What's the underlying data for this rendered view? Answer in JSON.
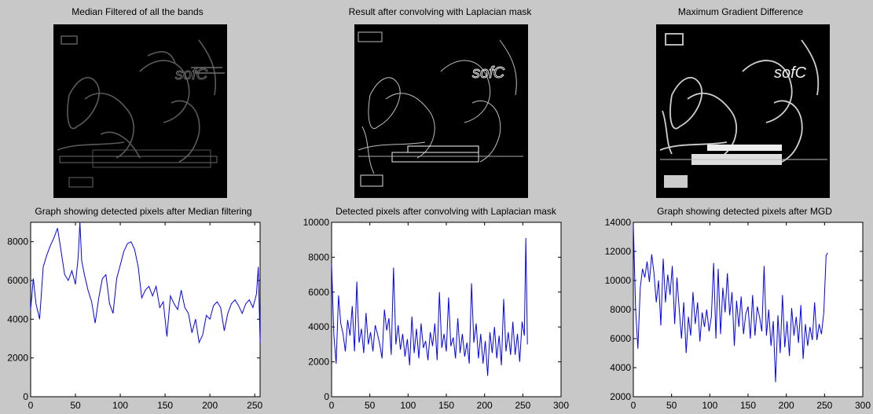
{
  "image_panels": [
    {
      "title": "Median Filtered of all the bands"
    },
    {
      "title": "Result after convolving with Laplacian mask"
    },
    {
      "title": "Maximum Gradient Difference"
    }
  ],
  "chart_data": [
    {
      "type": "line",
      "title": "Graph showing detected pixels after Median filtering",
      "xlabel": "",
      "ylabel": "",
      "xlim": [
        0,
        256
      ],
      "ylim": [
        0,
        9000
      ],
      "xticks": [
        0,
        50,
        100,
        150,
        200,
        250
      ],
      "yticks": [
        0,
        2000,
        4000,
        6000,
        8000
      ],
      "grid": false,
      "color": "#0000ff",
      "series": [
        {
          "x": [
            0,
            3,
            6,
            10,
            14,
            18,
            22,
            26,
            30,
            34,
            38,
            42,
            46,
            50,
            53,
            55,
            57,
            60,
            64,
            68,
            72,
            76,
            80,
            84,
            88,
            92,
            96,
            100,
            104,
            108,
            112,
            116,
            120,
            124,
            128,
            132,
            136,
            140,
            144,
            148,
            152,
            156,
            160,
            164,
            168,
            172,
            176,
            180,
            184,
            188,
            192,
            196,
            200,
            204,
            208,
            212,
            216,
            220,
            224,
            228,
            232,
            236,
            240,
            244,
            248,
            252,
            254,
            256
          ],
          "values": [
            4500,
            6100,
            4800,
            4000,
            6700,
            7300,
            7800,
            8200,
            8700,
            7500,
            6300,
            6000,
            6500,
            5800,
            7200,
            9000,
            7000,
            6300,
            5500,
            4900,
            3800,
            5100,
            6100,
            6300,
            4800,
            4300,
            6100,
            6800,
            7500,
            7900,
            8000,
            7600,
            6700,
            5100,
            5500,
            5700,
            5200,
            5700,
            4600,
            4900,
            3100,
            5200,
            4800,
            4500,
            5500,
            4600,
            4300,
            3300,
            4000,
            2800,
            3200,
            4200,
            4000,
            4700,
            4900,
            4600,
            3400,
            4300,
            4800,
            5000,
            4700,
            4300,
            4800,
            5000,
            4600,
            5300,
            6700,
            2800
          ]
        }
      ]
    },
    {
      "type": "line",
      "title": "Detected pixels after convolving with Laplacian mask",
      "xlabel": "",
      "ylabel": "",
      "xlim": [
        0,
        300
      ],
      "ylim": [
        0,
        10000
      ],
      "xticks": [
        0,
        50,
        100,
        150,
        200,
        250,
        300
      ],
      "yticks": [
        0,
        2000,
        4000,
        6000,
        8000,
        10000
      ],
      "grid": false,
      "color": "#0000ff",
      "series": [
        {
          "x": [
            0,
            3,
            6,
            9,
            12,
            15,
            18,
            21,
            24,
            27,
            30,
            33,
            36,
            39,
            42,
            45,
            48,
            51,
            54,
            57,
            60,
            63,
            66,
            69,
            72,
            75,
            78,
            81,
            84,
            87,
            90,
            93,
            96,
            99,
            102,
            105,
            108,
            111,
            114,
            117,
            120,
            123,
            126,
            129,
            132,
            135,
            138,
            141,
            144,
            147,
            150,
            153,
            156,
            159,
            162,
            165,
            168,
            171,
            174,
            177,
            180,
            183,
            186,
            189,
            192,
            195,
            198,
            201,
            204,
            207,
            210,
            213,
            216,
            219,
            222,
            225,
            228,
            231,
            234,
            237,
            240,
            243,
            246,
            249,
            252,
            254,
            256
          ],
          "values": [
            7600,
            3500,
            1900,
            5800,
            4200,
            3600,
            2600,
            4400,
            3500,
            5200,
            2600,
            6600,
            3100,
            3900,
            2500,
            4800,
            3000,
            3700,
            2600,
            4100,
            3600,
            3000,
            2200,
            5000,
            3800,
            4500,
            2400,
            7400,
            3000,
            4100,
            2700,
            3600,
            2300,
            3300,
            1800,
            4600,
            2500,
            3900,
            2200,
            4200,
            2800,
            3200,
            2100,
            3700,
            2900,
            4200,
            2100,
            6000,
            2800,
            3600,
            2600,
            5700,
            2900,
            3400,
            2200,
            4500,
            2500,
            3600,
            2300,
            3100,
            1900,
            6500,
            3100,
            4200,
            2200,
            3600,
            1900,
            3200,
            1200,
            3700,
            2500,
            4000,
            2200,
            3500,
            1800,
            5600,
            2600,
            3700,
            2400,
            4300,
            2400,
            3600,
            2000,
            4300,
            3500,
            9100,
            3000
          ]
        }
      ]
    },
    {
      "type": "line",
      "title": "Graph showing detected pixels after MGD",
      "xlabel": "",
      "ylabel": "",
      "xlim": [
        0,
        300
      ],
      "ylim": [
        2000,
        14000
      ],
      "xticks": [
        0,
        50,
        100,
        150,
        200,
        250,
        300
      ],
      "yticks": [
        2000,
        4000,
        6000,
        8000,
        10000,
        12000,
        14000
      ],
      "grid": false,
      "color": "#0000ff",
      "series": [
        {
          "x": [
            0,
            3,
            6,
            9,
            12,
            15,
            18,
            21,
            24,
            27,
            30,
            33,
            36,
            39,
            42,
            45,
            48,
            51,
            54,
            57,
            60,
            63,
            66,
            69,
            72,
            75,
            78,
            81,
            84,
            87,
            90,
            93,
            96,
            99,
            102,
            105,
            108,
            111,
            114,
            117,
            120,
            123,
            126,
            129,
            132,
            135,
            138,
            141,
            144,
            147,
            150,
            153,
            156,
            159,
            162,
            165,
            168,
            171,
            174,
            177,
            180,
            183,
            186,
            189,
            192,
            195,
            198,
            201,
            204,
            207,
            210,
            213,
            216,
            219,
            222,
            225,
            228,
            231,
            234,
            237,
            240,
            243,
            246,
            249,
            252,
            254
          ],
          "values": [
            13800,
            8000,
            5300,
            9500,
            10800,
            10200,
            11300,
            9900,
            11800,
            10500,
            8500,
            10000,
            6900,
            11500,
            8500,
            10400,
            9000,
            11000,
            7000,
            10200,
            8000,
            6000,
            8500,
            5000,
            7500,
            6200,
            9200,
            7000,
            8500,
            5800,
            7800,
            6800,
            8000,
            6500,
            7500,
            11200,
            6000,
            10800,
            6300,
            9500,
            7800,
            10500,
            7600,
            9200,
            5500,
            8600,
            6800,
            8900,
            6300,
            7700,
            8200,
            6000,
            9000,
            6200,
            8200,
            7500,
            6500,
            11000,
            6200,
            8000,
            5500,
            7200,
            3000,
            7600,
            5000,
            9000,
            5400,
            7200,
            4800,
            8100,
            6200,
            7500,
            5700,
            8300,
            4600,
            7000,
            5500,
            6800,
            5900,
            8500,
            5900,
            7000,
            6300,
            7800,
            11700,
            11900
          ]
        }
      ]
    }
  ]
}
